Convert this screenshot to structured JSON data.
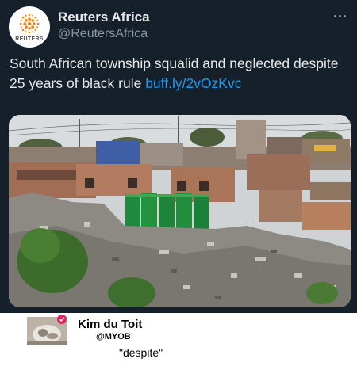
{
  "tweet": {
    "display_name": "Reuters Africa",
    "handle": "@ReutersAfrica",
    "avatar_logo_text": "REUTERS",
    "body_text": "South African township squalid and neglected despite 25 years of black rule ",
    "link_text": "buff.ly/2vOzKvc",
    "more_icon": "more-horizontal-icon",
    "photo_alt": "township-photo"
  },
  "reply": {
    "display_name": "Kim du Toit",
    "handle": "@MYOB",
    "text": "\"despite\"",
    "badge_icon": "check-badge-icon"
  },
  "colors": {
    "tweet_bg": "#15202b",
    "primary_text": "#e7e9ea",
    "secondary_text": "#8b98a5",
    "link": "#1d9bf0",
    "reuters_orange": "#ff8000",
    "toilet_green": "#1f8a3f",
    "badge_red": "#e0245e"
  }
}
